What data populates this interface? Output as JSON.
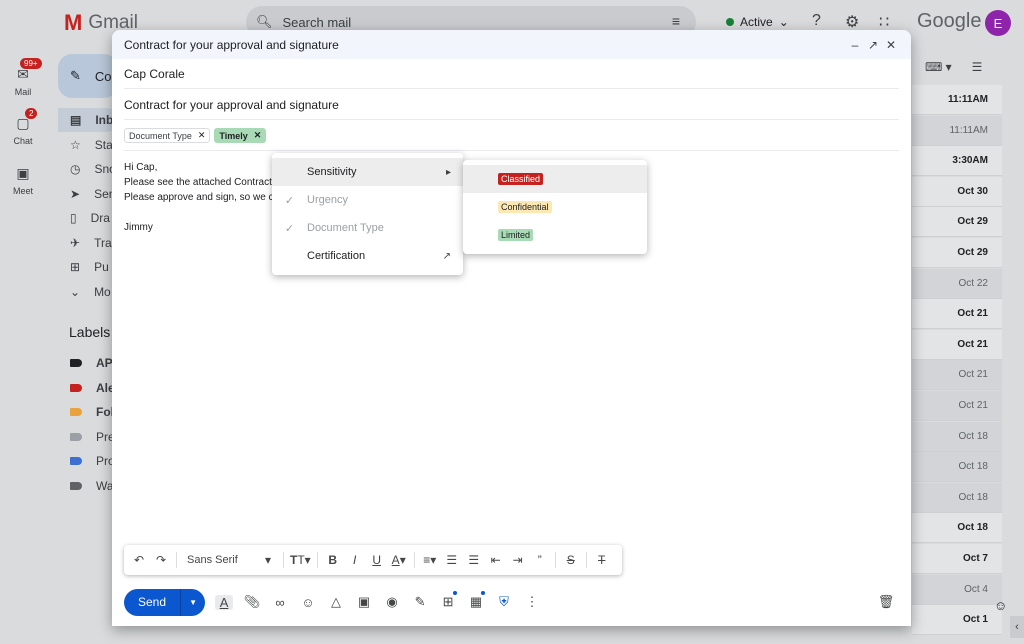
{
  "app": {
    "name": "Gmail",
    "google_word": "Google",
    "avatar_letter": "E"
  },
  "search": {
    "placeholder": "Search mail"
  },
  "status": {
    "label": "Active"
  },
  "rail": {
    "mail": {
      "label": "Mail",
      "badge": "99+"
    },
    "chat": {
      "label": "Chat",
      "badge": "2"
    },
    "meet": {
      "label": "Meet"
    }
  },
  "sidebar": {
    "compose_label": "Co",
    "items": [
      {
        "label": "Inb",
        "icon": "inbox-icon"
      },
      {
        "label": "Sta",
        "icon": "star-icon"
      },
      {
        "label": "Sno",
        "icon": "clock-icon"
      },
      {
        "label": "Sen",
        "icon": "send-icon"
      },
      {
        "label": "Dra",
        "icon": "draft-icon"
      },
      {
        "label": "Tra",
        "icon": "plane-icon"
      },
      {
        "label": "Pu",
        "icon": "cart-icon"
      },
      {
        "label": "Mo",
        "icon": "chevron-down-icon"
      }
    ],
    "labels_heading": "Labels",
    "labels": [
      {
        "label": "AP",
        "color": "#202124"
      },
      {
        "label": "Ale",
        "color": "#c5221f"
      },
      {
        "label": "Fol",
        "color": "#e8a33d"
      },
      {
        "label": "Pre",
        "color": "#9aa0a6"
      },
      {
        "label": "Pro",
        "color": "#3c6fd1"
      },
      {
        "label": "Wa",
        "color": "#5f6368"
      }
    ]
  },
  "mail_list": {
    "dates": [
      {
        "text": "11:11AM",
        "unread": true
      },
      {
        "text": "11:11AM",
        "unread": false
      },
      {
        "text": "3:30AM",
        "unread": true
      },
      {
        "text": "Oct 30",
        "unread": true
      },
      {
        "text": "Oct 29",
        "unread": true
      },
      {
        "text": "Oct 29",
        "unread": true
      },
      {
        "text": "Oct 22",
        "unread": false
      },
      {
        "text": "Oct 21",
        "unread": true
      },
      {
        "text": "Oct 21",
        "unread": true
      },
      {
        "text": "Oct 21",
        "unread": false
      },
      {
        "text": "Oct 21",
        "unread": false
      },
      {
        "text": "Oct 18",
        "unread": false
      },
      {
        "text": "Oct 18",
        "unread": false
      },
      {
        "text": "Oct 18",
        "unread": false
      },
      {
        "text": "Oct 18",
        "unread": true
      },
      {
        "text": "Oct 7",
        "unread": true
      },
      {
        "text": "Oct 4",
        "unread": false
      },
      {
        "text": "Oct 1",
        "unread": true
      }
    ]
  },
  "compose": {
    "window_title": "Contract for your approval and signature",
    "to": "Cap Corale",
    "subject": "Contract for your approval and signature",
    "chips": [
      {
        "label": "Document Type",
        "style": "outline"
      },
      {
        "label": "Timely",
        "style": "green"
      }
    ],
    "body": {
      "line1": "Hi Cap,",
      "line2": "Please see the attached Contract.",
      "line3": "Please approve and sign, so we c",
      "signature": "Jimmy"
    },
    "format_bar": {
      "font": "Sans Serif"
    },
    "send_label": "Send"
  },
  "label_menu": {
    "items": [
      {
        "label": "Sensitivity",
        "checked": false,
        "disabled": false,
        "trail": "▸"
      },
      {
        "label": "Urgency",
        "checked": true,
        "disabled": true,
        "trail": ""
      },
      {
        "label": "Document Type",
        "checked": true,
        "disabled": true,
        "trail": ""
      },
      {
        "label": "Certification",
        "checked": false,
        "disabled": false,
        "trail": "↗"
      }
    ]
  },
  "sensitivity_menu": {
    "items": [
      {
        "label": "Classified",
        "bg": "#c5221f",
        "fg": "#ffffff"
      },
      {
        "label": "Confidential",
        "bg": "#fce8b2",
        "fg": "#202124"
      },
      {
        "label": "Limited",
        "bg": "#a8dab5",
        "fg": "#202124"
      }
    ]
  }
}
